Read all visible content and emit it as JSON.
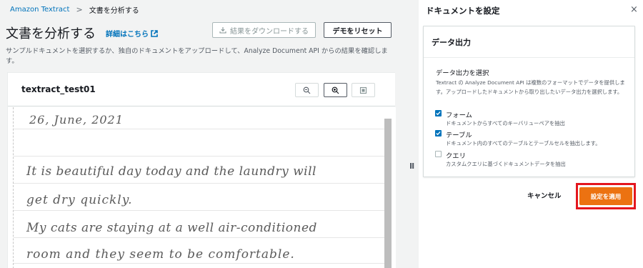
{
  "breadcrumb": {
    "root": "Amazon Textract",
    "separator": ">",
    "current": "文書を分析する"
  },
  "header": {
    "title": "文書を分析する",
    "info_link": "詳細はこちら",
    "download_label": "結果をダウンロードする",
    "reset_label": "デモをリセット",
    "description": "サンプルドキュメントを選択するか、独自のドキュメントをアップロードして、Analyze Document API からの結果を確認します。"
  },
  "document": {
    "name": "textract_test01",
    "zoom_out_icon": "zoom-out-icon",
    "zoom_in_icon": "zoom-in-icon",
    "fit_icon": "fit-page-icon",
    "lines": [
      "26, June, 2021",
      "It is beautiful day today and the laundry will",
      "get dry quickly.",
      "My cats are staying at a well air-conditioned",
      "room and they seem to be comfortable."
    ]
  },
  "splitter": "II",
  "panel": {
    "title": "ドキュメントを設定",
    "close": "×",
    "output": {
      "title": "データ出力",
      "select_label": "データ出力を選択",
      "select_desc": "Textract の Analyze Document API は複数のフォーマットでデータを提供します。アップロードしたドキュメントから取り出したいデータ出力を選択します。",
      "options": [
        {
          "label": "フォーム",
          "desc": "ドキュメントからすべてのキーバリューペアを抽出",
          "checked": true
        },
        {
          "label": "テーブル",
          "desc": "ドキュメント内のすべてのテーブルとテーブルセルを抽出します。",
          "checked": true
        },
        {
          "label": "クエリ",
          "desc": "カスタムクエリに基づくドキュメントデータを抽出",
          "checked": false
        }
      ]
    },
    "cancel_label": "キャンセル",
    "apply_label": "設定を適用"
  },
  "colors": {
    "link": "#0073bb",
    "primary_button": "#ec7211",
    "highlight_border": "#e4161e",
    "checkbox_checked": "#0073bb"
  }
}
